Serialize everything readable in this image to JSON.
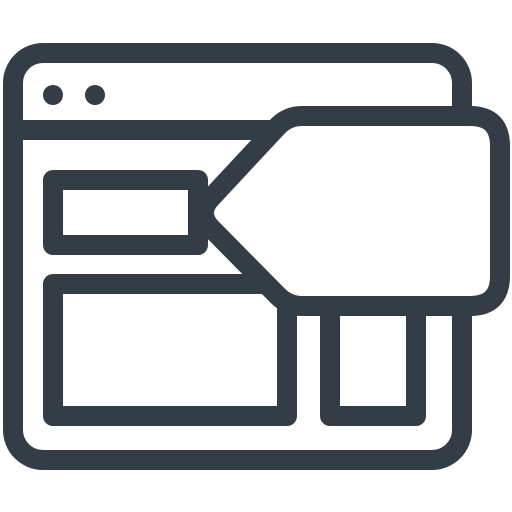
{
  "icon": {
    "name": "web-page-with-callout-tag",
    "stroke_color": "#343d45",
    "fill_color": "#ffffff"
  }
}
